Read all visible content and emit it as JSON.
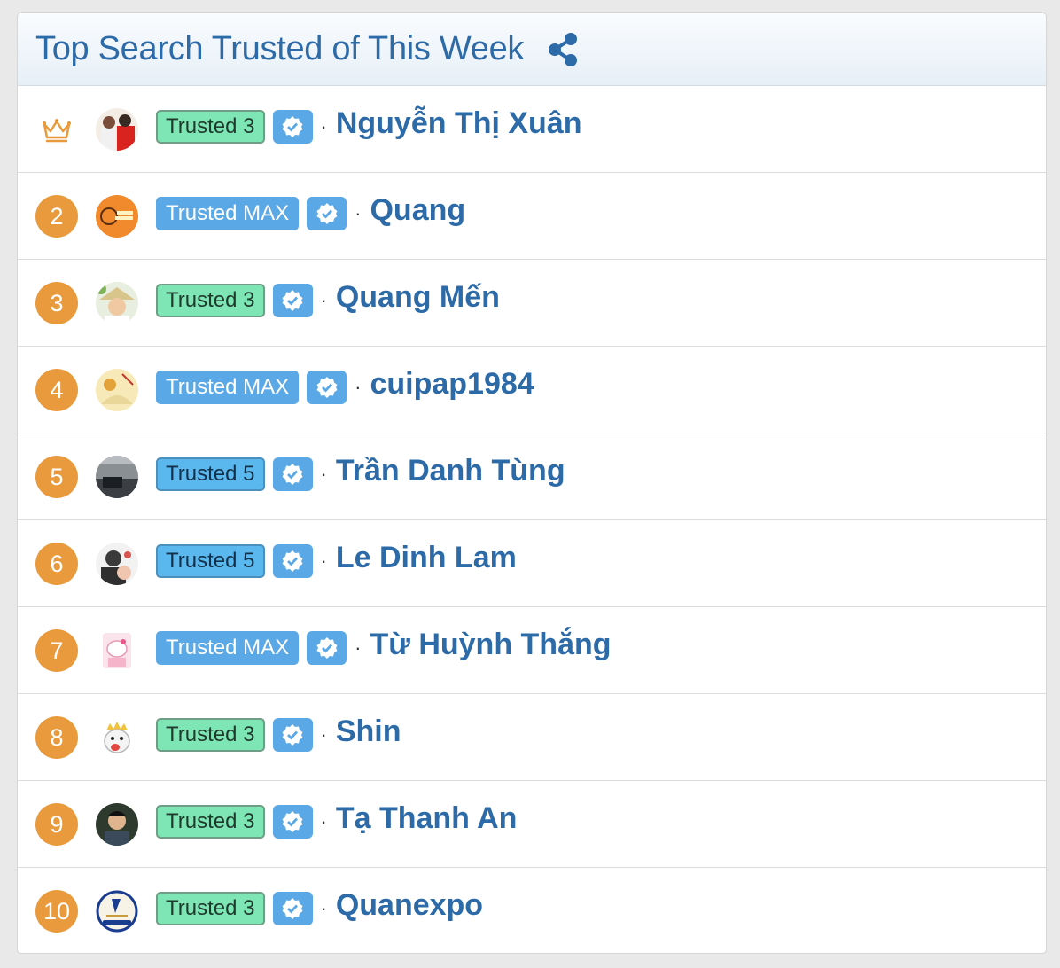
{
  "header": {
    "title": "Top Search Trusted of This Week",
    "share_icon": "share-icon"
  },
  "colors": {
    "title": "#2d6aa8",
    "rank_circle": "#e99a3c",
    "trusted_3": "#7ee6b4",
    "trusted_5": "#5ab8ee",
    "trusted_max": "#5aa8e6",
    "verified": "#5aa8e6"
  },
  "rows": [
    {
      "rank": "",
      "rank_icon": "crown-icon",
      "badge": "Trusted 3",
      "tier": "t3",
      "separator": "·",
      "name": "Nguyễn Thị Xuân"
    },
    {
      "rank": "2",
      "badge": "Trusted MAX",
      "tier": "tmax",
      "separator": "·",
      "name": "Quang"
    },
    {
      "rank": "3",
      "badge": "Trusted 3",
      "tier": "t3",
      "separator": "·",
      "name": "Quang Mến"
    },
    {
      "rank": "4",
      "badge": "Trusted MAX",
      "tier": "tmax",
      "separator": "·",
      "name": "cuipap1984"
    },
    {
      "rank": "5",
      "badge": "Trusted 5",
      "tier": "t5",
      "separator": "·",
      "name": "Trần Danh Tùng"
    },
    {
      "rank": "6",
      "badge": "Trusted 5",
      "tier": "t5",
      "separator": "·",
      "name": "Le Dinh Lam"
    },
    {
      "rank": "7",
      "badge": "Trusted MAX",
      "tier": "tmax",
      "separator": "·",
      "name": "Từ Huỳnh Thắng"
    },
    {
      "rank": "8",
      "badge": "Trusted 3",
      "tier": "t3",
      "separator": "·",
      "name": "Shin"
    },
    {
      "rank": "9",
      "badge": "Trusted 3",
      "tier": "t3",
      "separator": "·",
      "name": "Tạ Thanh An"
    },
    {
      "rank": "10",
      "badge": "Trusted 3",
      "tier": "t3",
      "separator": "·",
      "name": "Quanexpo"
    }
  ]
}
